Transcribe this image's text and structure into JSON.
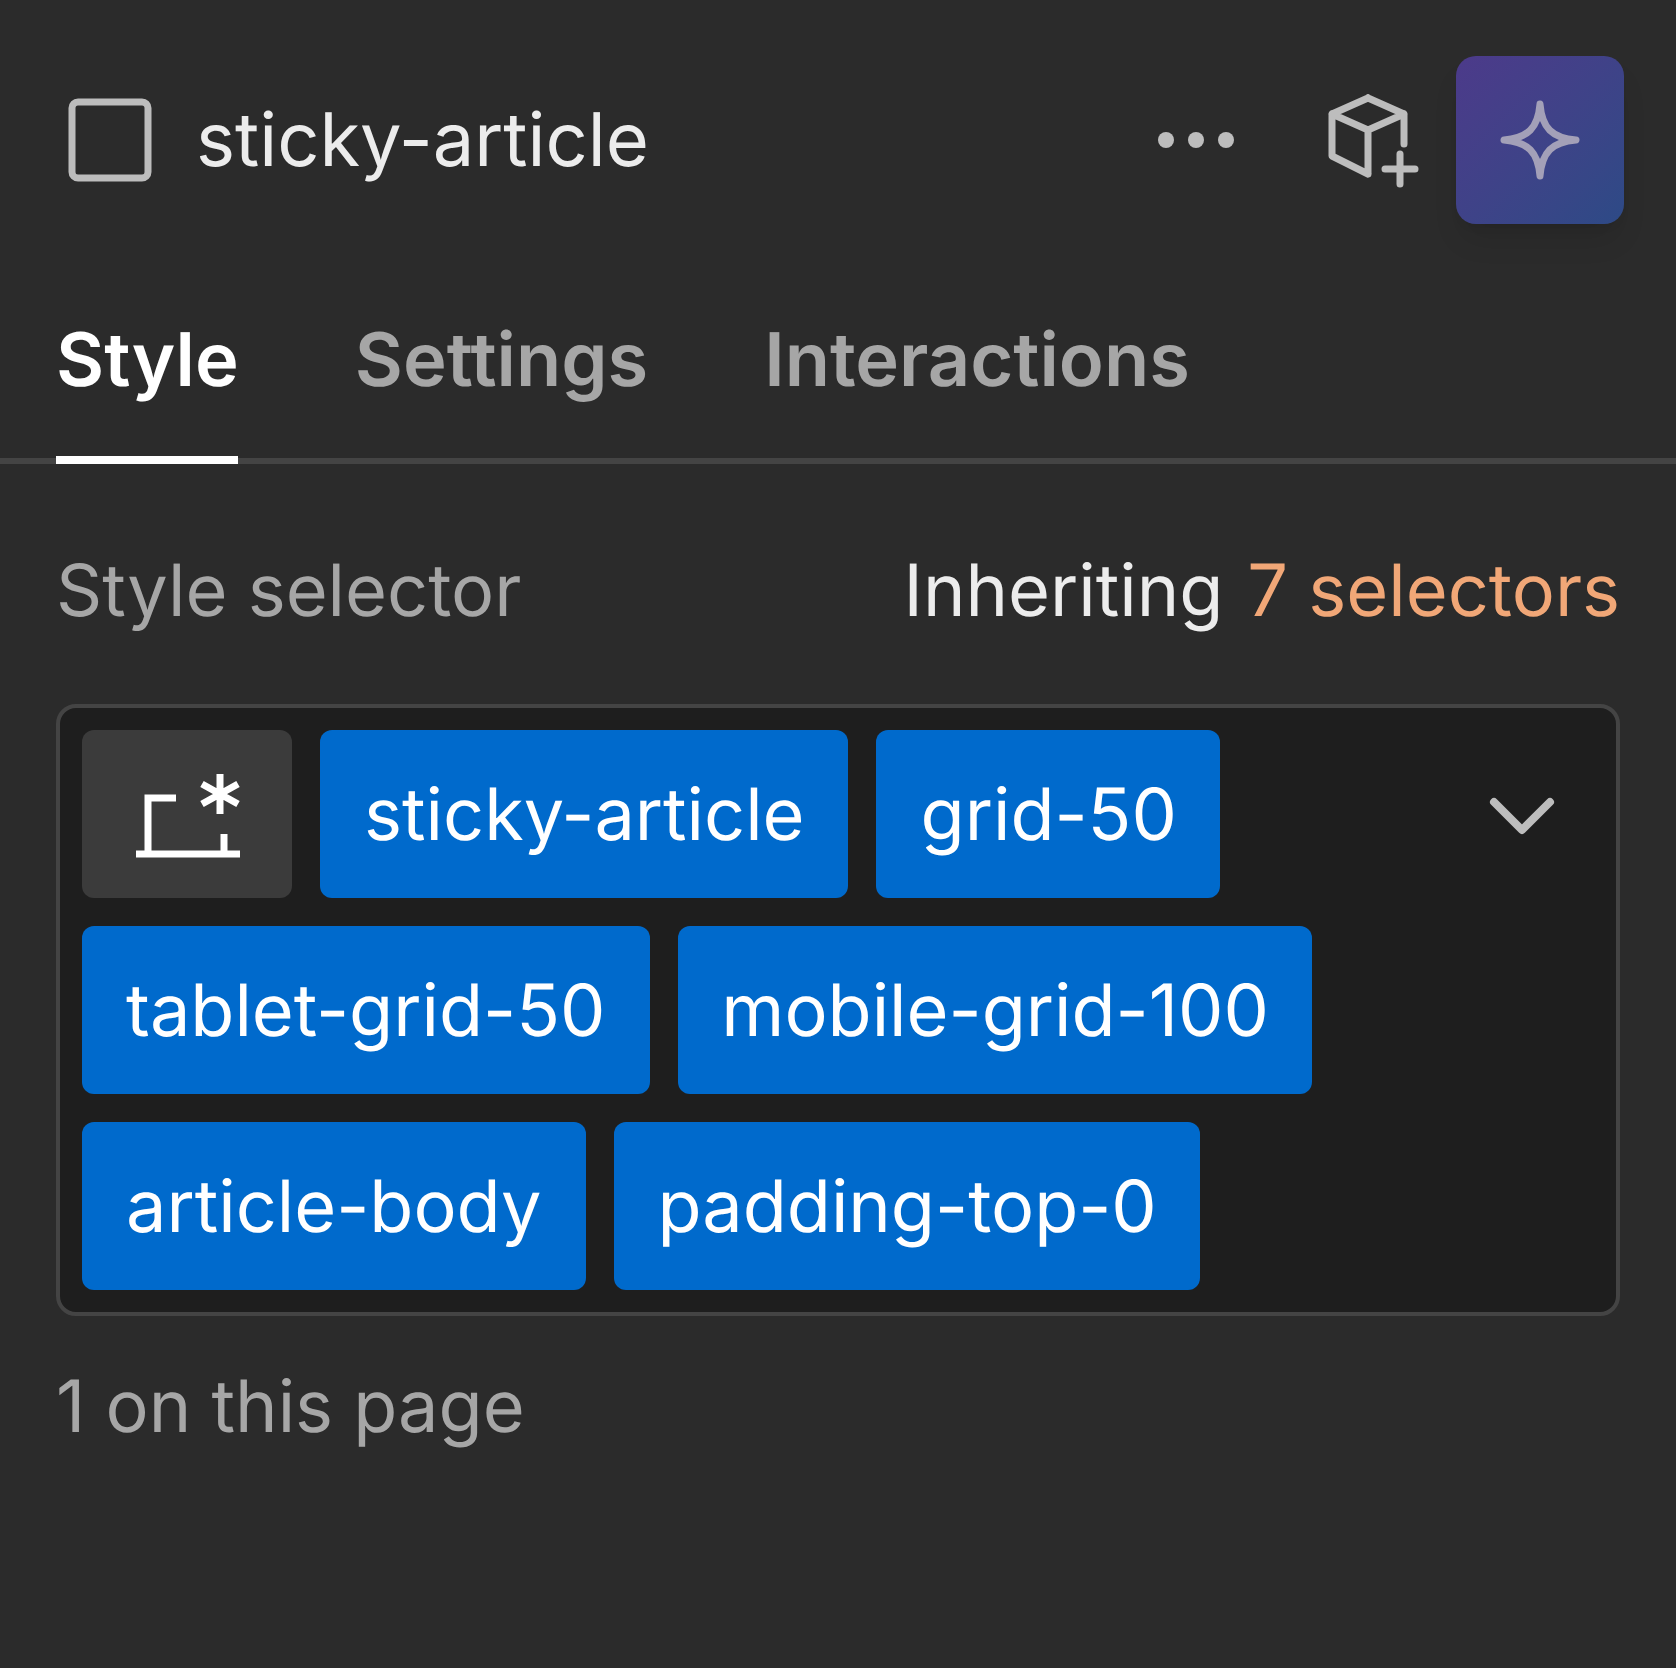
{
  "header": {
    "element_name": "sticky-article"
  },
  "tabs": [
    {
      "label": "Style",
      "selected": true
    },
    {
      "label": "Settings",
      "selected": false
    },
    {
      "label": "Interactions",
      "selected": false
    }
  ],
  "style_selector": {
    "label": "Style selector",
    "inheriting_prefix": "Inheriting",
    "inheriting_count": "7 selectors",
    "classes": [
      "sticky-article",
      "grid-50",
      "tablet-grid-50",
      "mobile-grid-100",
      "article-body",
      "padding-top-0"
    ],
    "usage": "1 on this page"
  }
}
